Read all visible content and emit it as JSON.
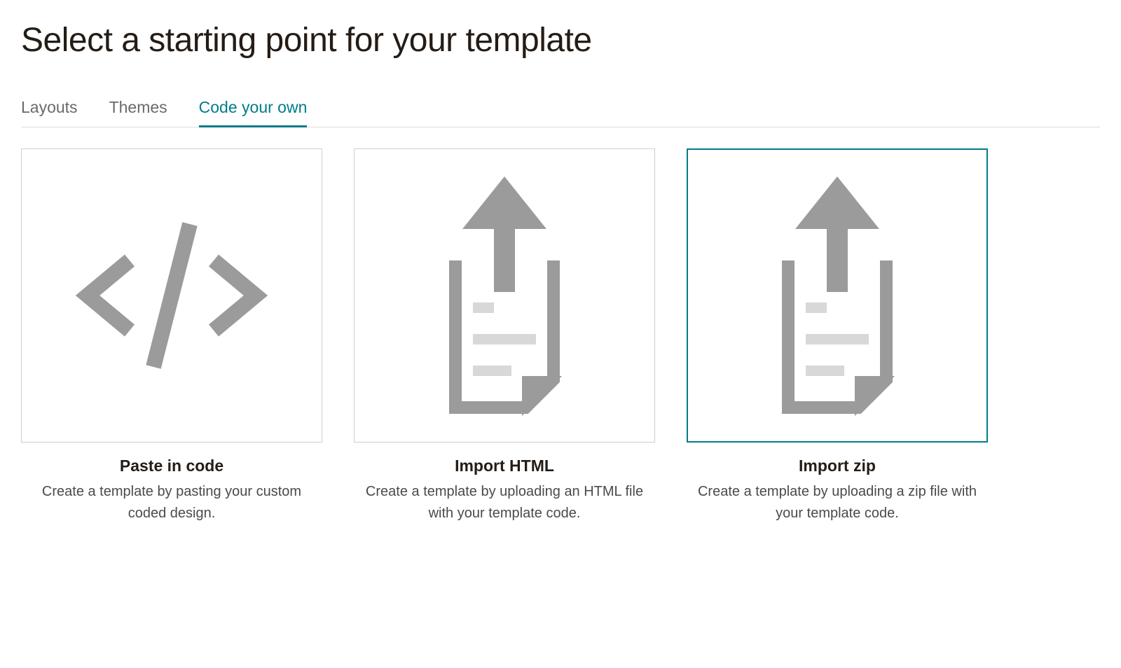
{
  "header": {
    "title": "Select a starting point for your template"
  },
  "tabs": [
    {
      "label": "Layouts",
      "active": false
    },
    {
      "label": "Themes",
      "active": false
    },
    {
      "label": "Code your own",
      "active": true
    }
  ],
  "cards": [
    {
      "id": "paste-in-code",
      "title": "Paste in code",
      "description": "Create a template by pasting your custom coded design.",
      "icon": "code-brackets-icon",
      "selected": false
    },
    {
      "id": "import-html",
      "title": "Import HTML",
      "description": "Create a template by uploading an HTML file with your template code.",
      "icon": "upload-document-icon",
      "selected": false
    },
    {
      "id": "import-zip",
      "title": "Import zip",
      "description": "Create a template by uploading a zip file with your template code.",
      "icon": "upload-document-icon",
      "selected": true
    }
  ]
}
